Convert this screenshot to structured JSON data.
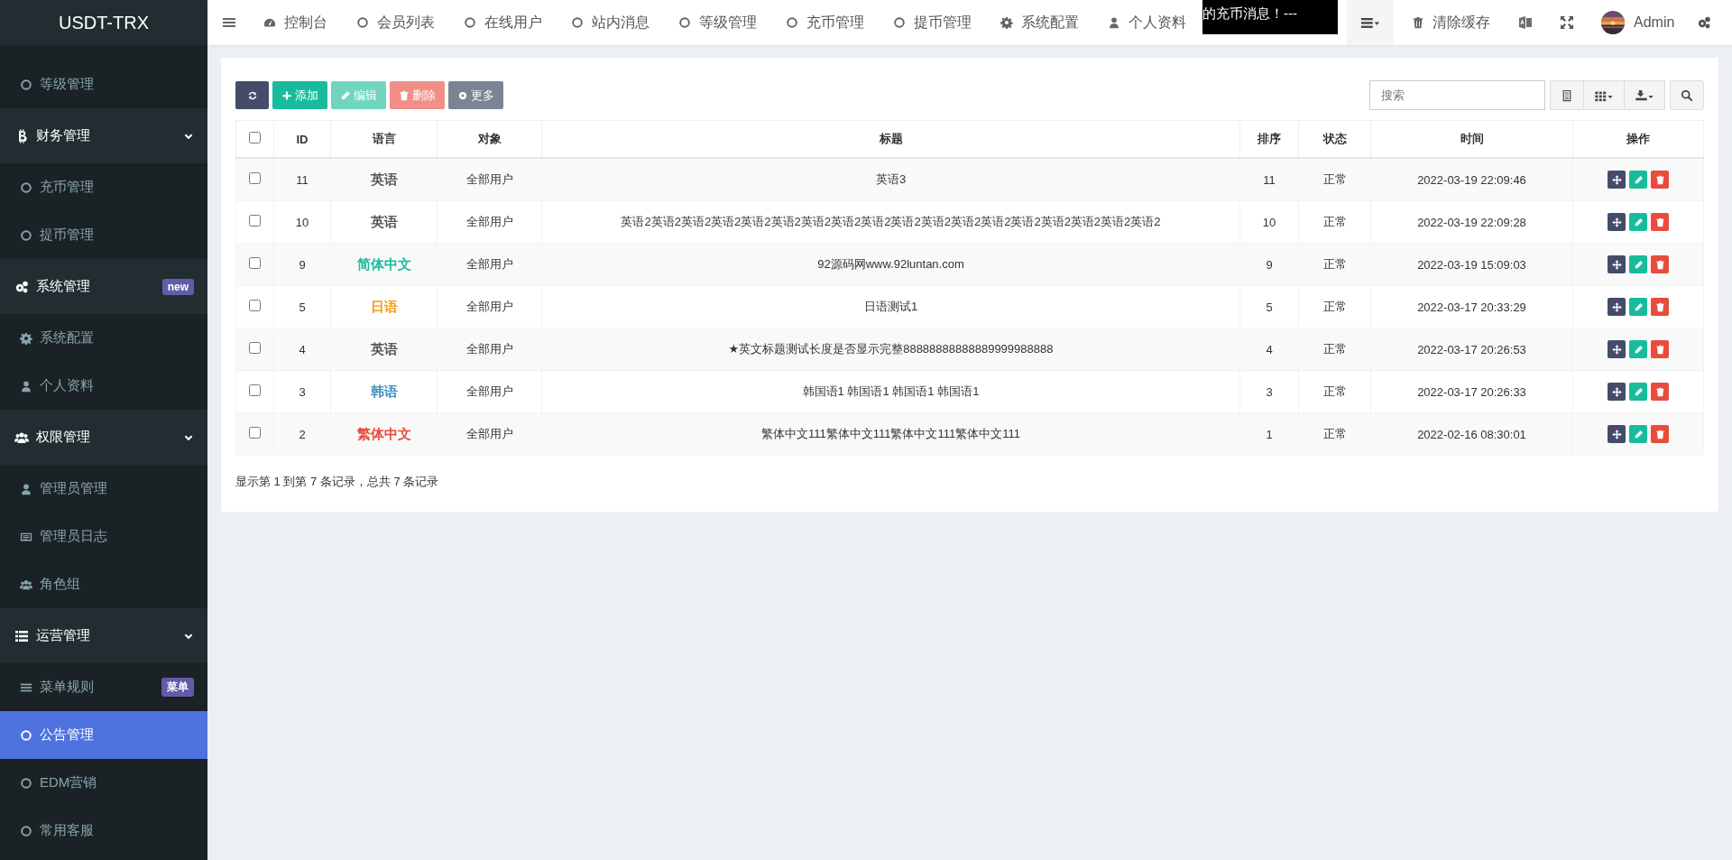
{
  "logo": "USDT-TRX",
  "top_nav": [
    {
      "label": "控制台"
    },
    {
      "label": "会员列表"
    },
    {
      "label": "在线用户"
    },
    {
      "label": "站内消息"
    },
    {
      "label": "等级管理"
    },
    {
      "label": "充币管理"
    },
    {
      "label": "提币管理"
    },
    {
      "label": "系统配置"
    },
    {
      "label": "个人资料"
    }
  ],
  "marquee": "的充币消息！---",
  "clear_cache": "清除缓存",
  "user": "Admin",
  "sidebar": [
    {
      "kind": "item",
      "label": "等级管理",
      "selected": false
    },
    {
      "kind": "header",
      "label": "财务管理",
      "expanded": true
    },
    {
      "kind": "item",
      "label": "充币管理",
      "selected": false
    },
    {
      "kind": "item",
      "label": "提币管理",
      "selected": false
    },
    {
      "kind": "header",
      "label": "系统管理",
      "badge": "new"
    },
    {
      "kind": "item",
      "label": "系统配置",
      "selected": false
    },
    {
      "kind": "item",
      "label": "个人资料",
      "selected": false
    },
    {
      "kind": "header",
      "label": "权限管理",
      "expanded": true
    },
    {
      "kind": "item",
      "label": "管理员管理",
      "selected": false
    },
    {
      "kind": "item",
      "label": "管理员日志",
      "selected": false
    },
    {
      "kind": "item",
      "label": "角色组",
      "selected": false
    },
    {
      "kind": "header",
      "label": "运营管理",
      "expanded": true
    },
    {
      "kind": "item",
      "label": "菜单规则",
      "selected": false,
      "badge": "菜单"
    },
    {
      "kind": "item",
      "label": "公告管理",
      "selected": true
    },
    {
      "kind": "item",
      "label": "EDM营销",
      "selected": false
    },
    {
      "kind": "item",
      "label": "常用客服",
      "selected": false
    }
  ],
  "toolbar": [
    {
      "kind": "refresh",
      "disabled": false
    },
    {
      "kind": "add",
      "label": "添加",
      "disabled": false
    },
    {
      "kind": "edit",
      "label": "编辑",
      "disabled": true
    },
    {
      "kind": "delete",
      "label": "删除",
      "disabled": true
    },
    {
      "kind": "more",
      "label": "更多",
      "disabled": false
    }
  ],
  "search": {
    "placeholder": "搜索"
  },
  "table": {
    "columns": [
      "ID",
      "语言",
      "对象",
      "标题",
      "排序",
      "状态",
      "时间",
      "操作"
    ],
    "header_checked": false,
    "rows": [
      {
        "checked": false,
        "id": "11",
        "language": "英语",
        "color": "#555555",
        "target": "全部用户",
        "title": "英语3",
        "sort": "11",
        "status": "正常",
        "time": "2022-03-19 22:09:46"
      },
      {
        "checked": false,
        "id": "10",
        "language": "英语",
        "color": "#555555",
        "target": "全部用户",
        "title": "英语2英语2英语2英语2英语2英语2英语2英语2英语2英语2英语2英语2英语2英语2英语2英语2英语2英语2",
        "sort": "10",
        "status": "正常",
        "time": "2022-03-19 22:09:28"
      },
      {
        "checked": false,
        "id": "9",
        "language": "简体中文",
        "color": "#18bc9c",
        "target": "全部用户",
        "title": "92源码网www.92luntan.com",
        "sort": "9",
        "status": "正常",
        "time": "2022-03-19 15:09:03"
      },
      {
        "checked": false,
        "id": "5",
        "language": "日语",
        "color": "#f39c12",
        "target": "全部用户",
        "title": "日语测试1",
        "sort": "5",
        "status": "正常",
        "time": "2022-03-17 20:33:29"
      },
      {
        "checked": false,
        "id": "4",
        "language": "英语",
        "color": "#555555",
        "target": "全部用户",
        "title": "★英文标题测试长度是否显示完整88888888888889999988888",
        "sort": "4",
        "status": "正常",
        "time": "2022-03-17 20:26:53"
      },
      {
        "checked": false,
        "id": "3",
        "language": "韩语",
        "color": "#3c8dbc",
        "target": "全部用户",
        "title": "韩国语1 韩国语1 韩国语1 韩国语1",
        "sort": "3",
        "status": "正常",
        "time": "2022-03-17 20:26:33"
      },
      {
        "checked": false,
        "id": "2",
        "language": "繁体中文",
        "color": "#e74c3c",
        "target": "全部用户",
        "title": "繁体中文111繁体中文111繁体中文111繁体中文111",
        "sort": "1",
        "status": "正常",
        "time": "2022-02-16 08:30:01"
      }
    ]
  },
  "pagination_info": "显示第 1 到第 7 条记录，总共 7 条记录"
}
